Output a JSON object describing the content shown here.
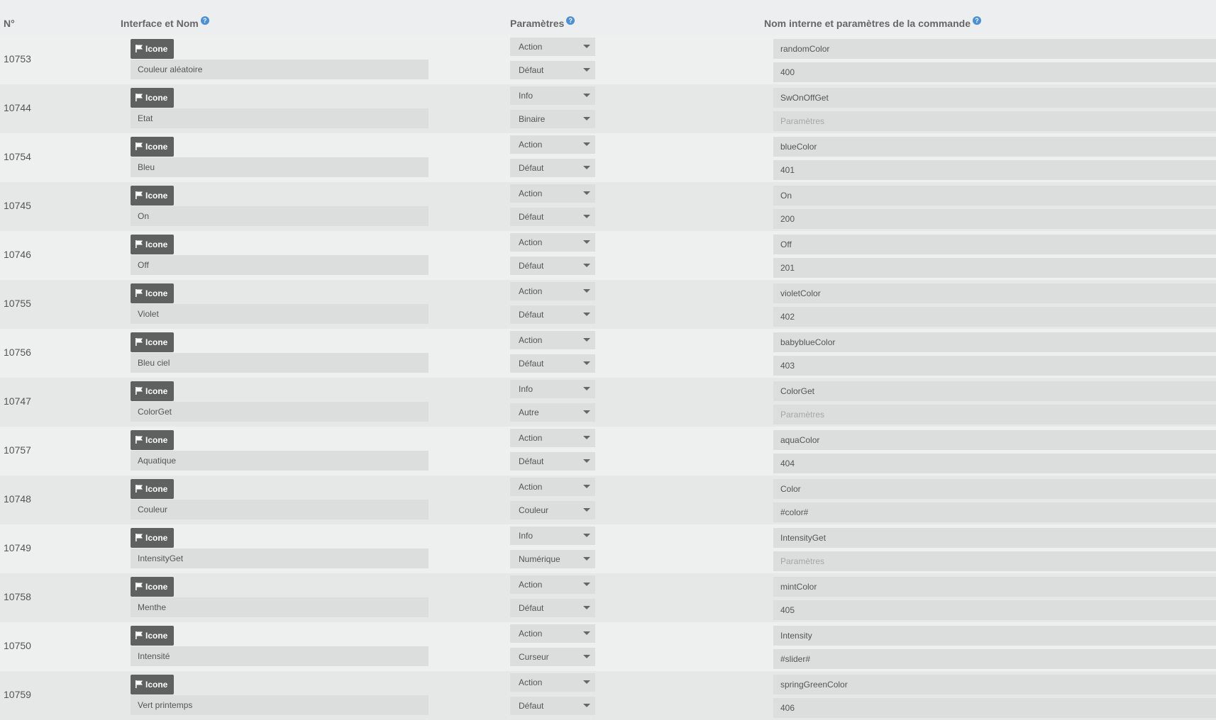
{
  "headers": {
    "num": "N°",
    "interface": "Interface et Nom",
    "params": "Paramètres",
    "internal": "Nom interne et paramètres de la commande"
  },
  "icon_label": "Icone",
  "rows": [
    {
      "id": "10753",
      "name": "Couleur aléatoire",
      "type": "Action",
      "subtype": "Défaut",
      "logicalId": "randomColor",
      "param": "400"
    },
    {
      "id": "10744",
      "name": "Etat",
      "type": "Info",
      "subtype": "Binaire",
      "logicalId": "SwOnOffGet",
      "param": "",
      "param_placeholder": "Paramètres"
    },
    {
      "id": "10754",
      "name": "Bleu",
      "type": "Action",
      "subtype": "Défaut",
      "logicalId": "blueColor",
      "param": "401"
    },
    {
      "id": "10745",
      "name": "On",
      "type": "Action",
      "subtype": "Défaut",
      "logicalId": "On",
      "param": "200"
    },
    {
      "id": "10746",
      "name": "Off",
      "type": "Action",
      "subtype": "Défaut",
      "logicalId": "Off",
      "param": "201"
    },
    {
      "id": "10755",
      "name": "Violet",
      "type": "Action",
      "subtype": "Défaut",
      "logicalId": "violetColor",
      "param": "402"
    },
    {
      "id": "10756",
      "name": "Bleu ciel",
      "type": "Action",
      "subtype": "Défaut",
      "logicalId": "babyblueColor",
      "param": "403"
    },
    {
      "id": "10747",
      "name": "ColorGet",
      "type": "Info",
      "subtype": "Autre",
      "logicalId": "ColorGet",
      "param": "",
      "param_placeholder": "Paramètres"
    },
    {
      "id": "10757",
      "name": "Aquatique",
      "type": "Action",
      "subtype": "Défaut",
      "logicalId": "aquaColor",
      "param": "404"
    },
    {
      "id": "10748",
      "name": "Couleur",
      "type": "Action",
      "subtype": "Couleur",
      "logicalId": "Color",
      "param": "#color#"
    },
    {
      "id": "10749",
      "name": "IntensityGet",
      "type": "Info",
      "subtype": "Numérique",
      "logicalId": "IntensityGet",
      "param": "",
      "param_placeholder": "Paramètres"
    },
    {
      "id": "10758",
      "name": "Menthe",
      "type": "Action",
      "subtype": "Défaut",
      "logicalId": "mintColor",
      "param": "405"
    },
    {
      "id": "10750",
      "name": "Intensité",
      "type": "Action",
      "subtype": "Curseur",
      "logicalId": "Intensity",
      "param": "#slider#"
    },
    {
      "id": "10759",
      "name": "Vert printemps",
      "type": "Action",
      "subtype": "Défaut",
      "logicalId": "springGreenColor",
      "param": "406"
    }
  ]
}
